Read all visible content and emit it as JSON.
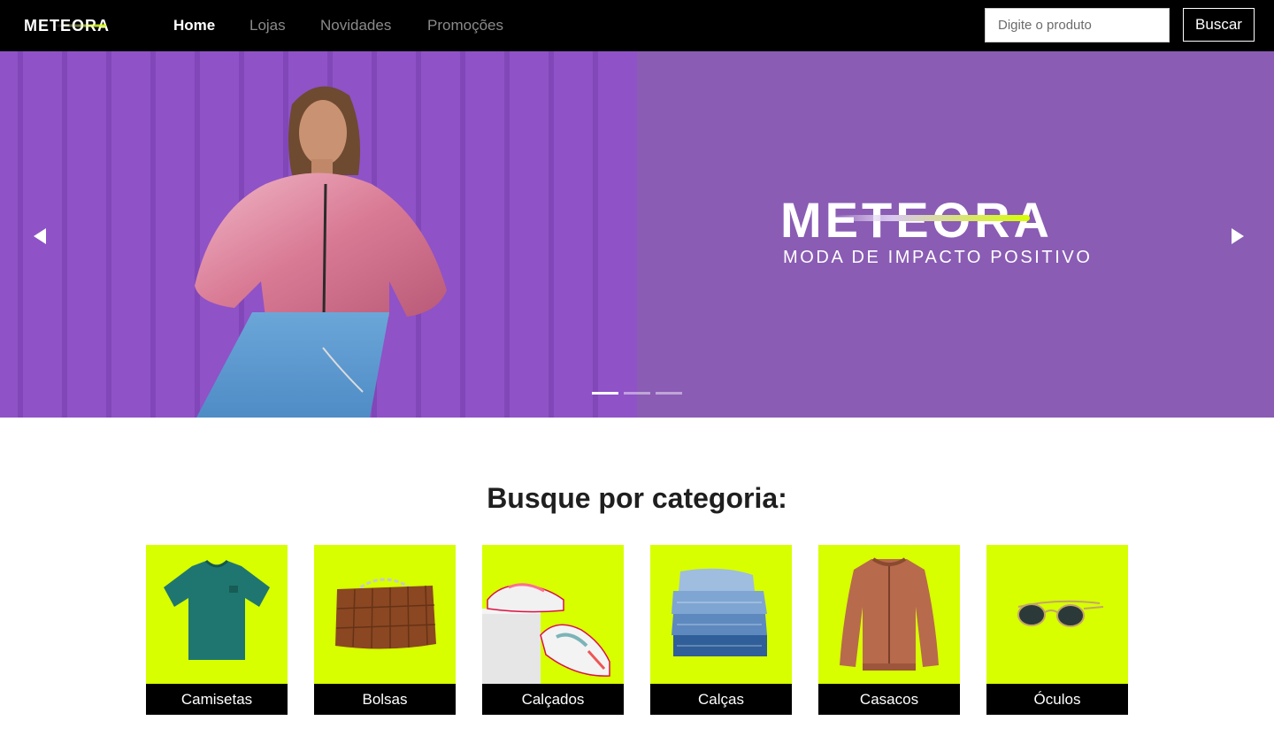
{
  "brand": {
    "name": "METEORA",
    "tagline": "MODA DE IMPACTO POSITIVO"
  },
  "nav": {
    "links": [
      "Home",
      "Lojas",
      "Novidades",
      "Promoções"
    ],
    "active": "Home"
  },
  "search": {
    "placeholder": "Digite o produto",
    "value": "",
    "button_label": "Buscar"
  },
  "hero": {
    "slides_count": 3,
    "active_slide": 1,
    "left_arrow_icon": "triangle-left-icon",
    "right_arrow_icon": "triangle-right-icon"
  },
  "categories": {
    "title": "Busque por categoria:",
    "items": [
      {
        "label": "Camisetas",
        "icon": "tshirt-icon"
      },
      {
        "label": "Bolsas",
        "icon": "handbag-icon"
      },
      {
        "label": "Calçados",
        "icon": "sneakers-icon"
      },
      {
        "label": "Calças",
        "icon": "jeans-icon"
      },
      {
        "label": "Casacos",
        "icon": "jacket-icon"
      },
      {
        "label": "Óculos",
        "icon": "sunglasses-icon"
      }
    ]
  },
  "colors": {
    "nav_bg": "#000000",
    "hero_purple": "#8a5cb4",
    "accent_lime": "#d7ff00",
    "text_dark": "#1f1f1f"
  }
}
